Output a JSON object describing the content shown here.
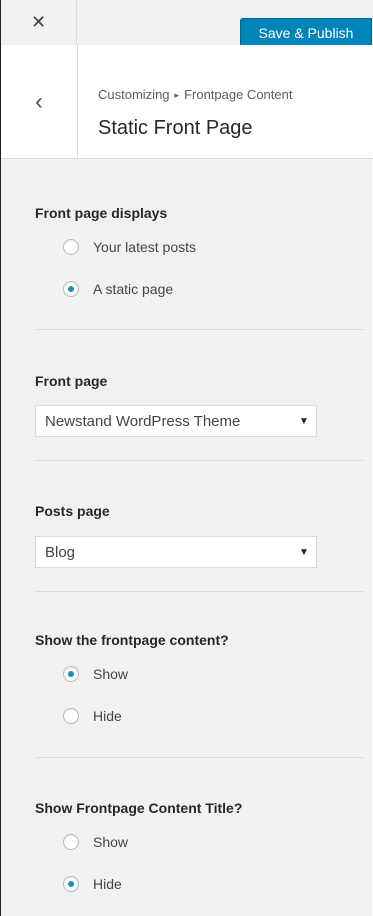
{
  "header": {
    "close_icon": "close-icon",
    "save_label": "Save & Publish"
  },
  "section": {
    "back_icon": "chevron-left-icon",
    "breadcrumb_root": "Customizing",
    "breadcrumb_sep": "▸",
    "breadcrumb_parent": "Frontpage Content",
    "title": "Static Front Page"
  },
  "front_page_displays": {
    "title": "Front page displays",
    "options": [
      {
        "label": "Your latest posts",
        "checked": false
      },
      {
        "label": "A static page",
        "checked": true
      }
    ]
  },
  "front_page": {
    "title": "Front page",
    "selected": "Newstand WordPress Theme"
  },
  "posts_page": {
    "title": "Posts page",
    "selected": "Blog"
  },
  "show_frontpage_content": {
    "title": "Show the frontpage content?",
    "options": [
      {
        "label": "Show",
        "checked": true
      },
      {
        "label": "Hide",
        "checked": false
      }
    ]
  },
  "show_frontpage_content_title": {
    "title": "Show Frontpage Content Title?",
    "options": [
      {
        "label": "Show",
        "checked": false
      },
      {
        "label": "Hide",
        "checked": true
      }
    ]
  },
  "colors": {
    "accent": "#0085ba",
    "radio_dot": "#1e8cbe",
    "panel_bg": "#f1f1f1"
  }
}
